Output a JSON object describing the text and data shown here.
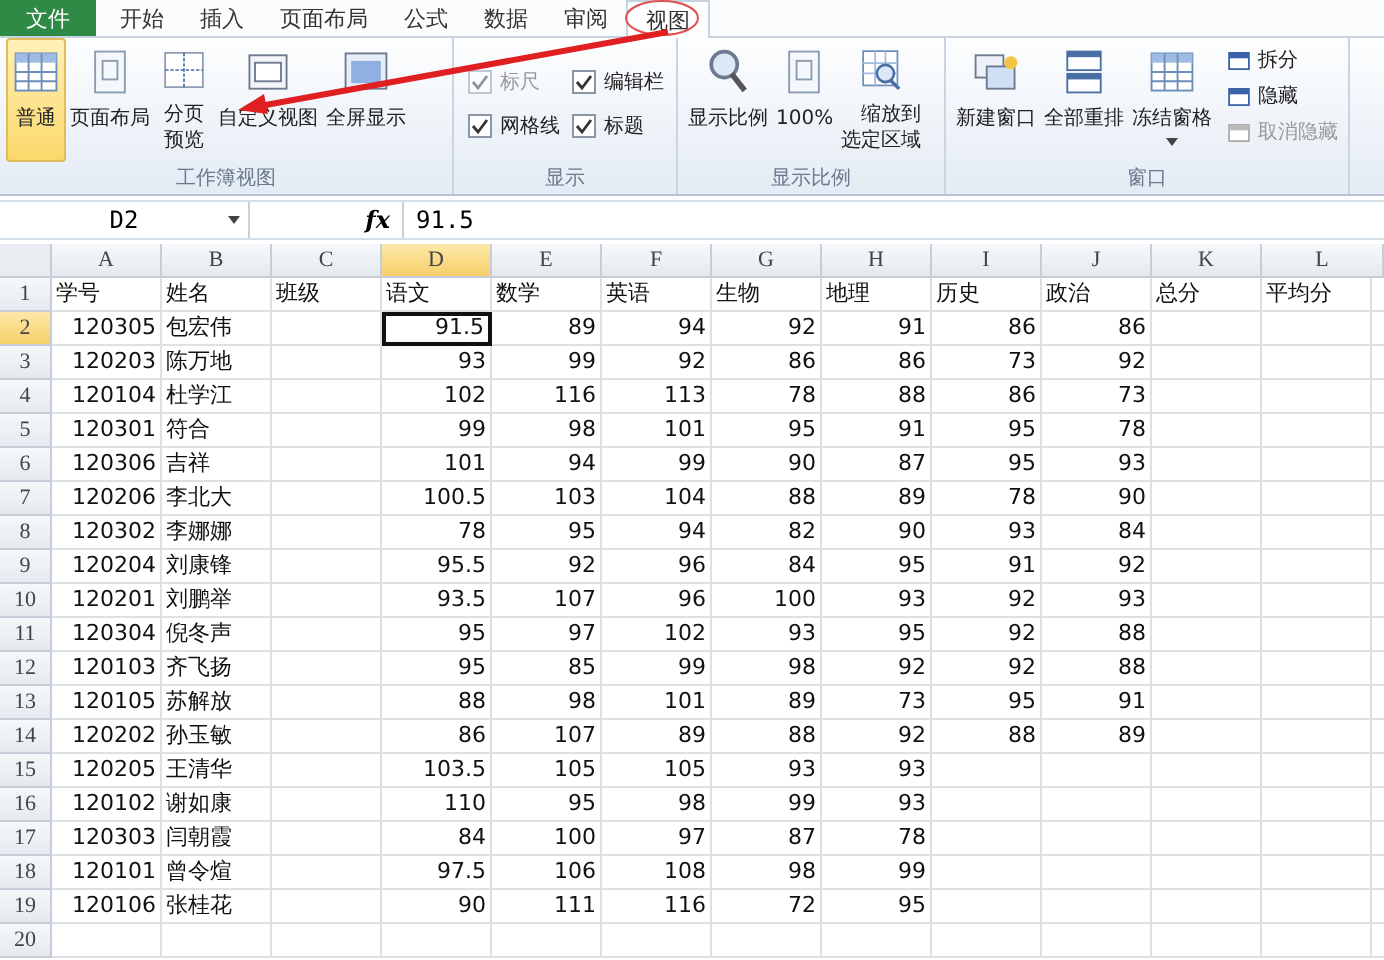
{
  "tabs": [
    {
      "label": "文件",
      "kind": "file",
      "selected": false
    },
    {
      "label": "开始",
      "kind": "tab",
      "selected": false
    },
    {
      "label": "插入",
      "kind": "tab",
      "selected": false
    },
    {
      "label": "页面布局",
      "kind": "tab",
      "selected": false
    },
    {
      "label": "公式",
      "kind": "tab",
      "selected": false
    },
    {
      "label": "数据",
      "kind": "tab",
      "selected": false
    },
    {
      "label": "审阅",
      "kind": "tab",
      "selected": false
    },
    {
      "label": "视图",
      "kind": "tab",
      "selected": true
    }
  ],
  "groups": [
    {
      "label": "工作簿视图",
      "items": [
        {
          "kind": "large",
          "label": "普通",
          "selected": true
        },
        {
          "kind": "large",
          "label": "页面布局",
          "selected": false
        },
        {
          "kind": "large",
          "label": "分页预览",
          "selected": false,
          "wrap": true
        },
        {
          "kind": "large",
          "label": "自定义视图",
          "selected": false
        },
        {
          "kind": "large",
          "label": "全屏显示",
          "selected": false
        }
      ]
    },
    {
      "label": "显示",
      "items": [
        {
          "kind": "check",
          "label": "标尺",
          "checked": true,
          "disabled": true
        },
        {
          "kind": "check",
          "label": "编辑栏",
          "checked": true,
          "disabled": false
        },
        {
          "kind": "check",
          "label": "网格线",
          "checked": true,
          "disabled": false
        },
        {
          "kind": "check",
          "label": "标题",
          "checked": true,
          "disabled": false
        }
      ]
    },
    {
      "label": "显示比例",
      "items": [
        {
          "kind": "large",
          "label": "显示比例"
        },
        {
          "kind": "large",
          "label": "100%"
        },
        {
          "kind": "large",
          "label": "缩放到选定区域",
          "wrap": true
        }
      ]
    },
    {
      "label": "窗口",
      "items": [
        {
          "kind": "large",
          "label": "新建窗口"
        },
        {
          "kind": "large",
          "label": "全部重排"
        },
        {
          "kind": "dropdown",
          "label": "冻结窗格"
        },
        {
          "kind": "small",
          "label": "拆分",
          "disabled": false
        },
        {
          "kind": "small",
          "label": "隐藏",
          "disabled": false
        },
        {
          "kind": "small",
          "label": "取消隐藏",
          "disabled": true
        }
      ]
    }
  ],
  "formula_bar": {
    "name_box": "D2",
    "function_label": "fx",
    "value": "91.5"
  },
  "sheet": {
    "columns": [
      {
        "label": "A",
        "selected": false,
        "kind": "number"
      },
      {
        "label": "B",
        "selected": false,
        "kind": "text"
      },
      {
        "label": "C",
        "selected": false
      },
      {
        "label": "D",
        "selected": true,
        "kind": "number"
      },
      {
        "label": "E",
        "selected": false,
        "kind": "number"
      },
      {
        "label": "F",
        "selected": false,
        "kind": "number"
      },
      {
        "label": "G",
        "selected": false,
        "kind": "number"
      },
      {
        "label": "H",
        "selected": false,
        "kind": "number"
      },
      {
        "label": "I",
        "selected": false,
        "kind": "number"
      },
      {
        "label": "J",
        "selected": false,
        "kind": "number"
      },
      {
        "label": "K",
        "selected": false
      },
      {
        "label": "L",
        "selected": false
      }
    ],
    "header_row": {
      "number": "1",
      "selected": false,
      "cells": [
        "学号",
        "姓名",
        "班级",
        "语文",
        "数学",
        "英语",
        "生物",
        "地理",
        "历史",
        "政治",
        "总分",
        "平均分"
      ]
    },
    "rows": [
      {
        "number": "2",
        "selected": true,
        "cells": [
          "120305",
          "包宏伟",
          null,
          "91.5",
          "89",
          "94",
          "92",
          "91",
          "86",
          "86",
          null,
          null
        ]
      },
      {
        "number": "3",
        "selected": false,
        "cells": [
          "120203",
          "陈万地",
          null,
          "93",
          "99",
          "92",
          "86",
          "86",
          "73",
          "92",
          null,
          null
        ]
      },
      {
        "number": "4",
        "selected": false,
        "cells": [
          "120104",
          "杜学江",
          null,
          "102",
          "116",
          "113",
          "78",
          "88",
          "86",
          "73",
          null,
          null
        ]
      },
      {
        "number": "5",
        "selected": false,
        "cells": [
          "120301",
          "符合",
          null,
          "99",
          "98",
          "101",
          "95",
          "91",
          "95",
          "78",
          null,
          null
        ]
      },
      {
        "number": "6",
        "selected": false,
        "cells": [
          "120306",
          "吉祥",
          null,
          "101",
          "94",
          "99",
          "90",
          "87",
          "95",
          "93",
          null,
          null
        ]
      },
      {
        "number": "7",
        "selected": false,
        "cells": [
          "120206",
          "李北大",
          null,
          "100.5",
          "103",
          "104",
          "88",
          "89",
          "78",
          "90",
          null,
          null
        ]
      },
      {
        "number": "8",
        "selected": false,
        "cells": [
          "120302",
          "李娜娜",
          null,
          "78",
          "95",
          "94",
          "82",
          "90",
          "93",
          "84",
          null,
          null
        ]
      },
      {
        "number": "9",
        "selected": false,
        "cells": [
          "120204",
          "刘康锋",
          null,
          "95.5",
          "92",
          "96",
          "84",
          "95",
          "91",
          "92",
          null,
          null
        ]
      },
      {
        "number": "10",
        "selected": false,
        "cells": [
          "120201",
          "刘鹏举",
          null,
          "93.5",
          "107",
          "96",
          "100",
          "93",
          "92",
          "93",
          null,
          null
        ]
      },
      {
        "number": "11",
        "selected": false,
        "cells": [
          "120304",
          "倪冬声",
          null,
          "95",
          "97",
          "102",
          "93",
          "95",
          "92",
          "88",
          null,
          null
        ]
      },
      {
        "number": "12",
        "selected": false,
        "cells": [
          "120103",
          "齐飞扬",
          null,
          "95",
          "85",
          "99",
          "98",
          "92",
          "92",
          "88",
          null,
          null
        ]
      },
      {
        "number": "13",
        "selected": false,
        "cells": [
          "120105",
          "苏解放",
          null,
          "88",
          "98",
          "101",
          "89",
          "73",
          "95",
          "91",
          null,
          null
        ]
      },
      {
        "number": "14",
        "selected": false,
        "cells": [
          "120202",
          "孙玉敏",
          null,
          "86",
          "107",
          "89",
          "88",
          "92",
          "88",
          "89",
          null,
          null
        ]
      },
      {
        "number": "15",
        "selected": false,
        "cells": [
          "120205",
          "王清华",
          null,
          "103.5",
          "105",
          "105",
          "93",
          "93",
          null,
          null,
          null,
          null
        ]
      },
      {
        "number": "16",
        "selected": false,
        "cells": [
          "120102",
          "谢如康",
          null,
          "110",
          "95",
          "98",
          "99",
          "93",
          null,
          null,
          null,
          null
        ]
      },
      {
        "number": "17",
        "selected": false,
        "cells": [
          "120303",
          "闫朝霞",
          null,
          "84",
          "100",
          "97",
          "87",
          "78",
          null,
          null,
          null,
          null
        ]
      },
      {
        "number": "18",
        "selected": false,
        "cells": [
          "120101",
          "曾令煊",
          null,
          "97.5",
          "106",
          "108",
          "98",
          "99",
          null,
          null,
          null,
          null
        ]
      },
      {
        "number": "19",
        "selected": false,
        "cells": [
          "120106",
          "张桂花",
          null,
          "90",
          "111",
          "116",
          "72",
          "95",
          null,
          null,
          null,
          null
        ]
      },
      {
        "number": "20",
        "selected": false,
        "cells": [
          null,
          null,
          null,
          null,
          null,
          null,
          null,
          null,
          null,
          null,
          null,
          null
        ]
      }
    ]
  }
}
